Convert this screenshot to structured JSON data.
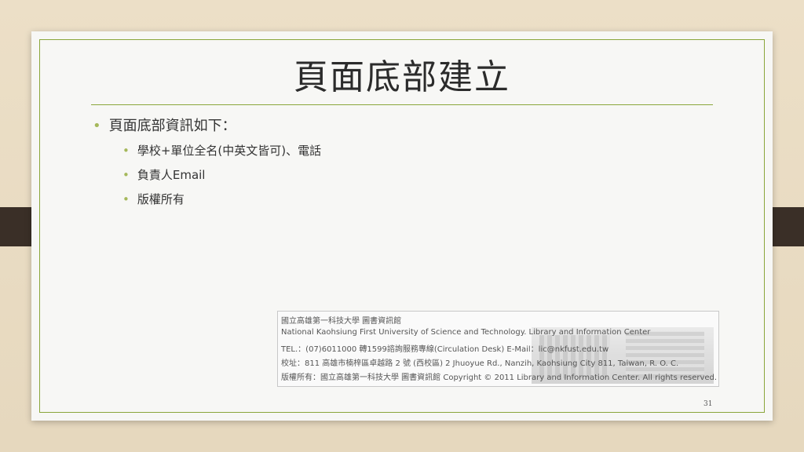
{
  "slide": {
    "title": "頁面底部建立",
    "main_bullet": "頁面底部資訊如下：",
    "sub_bullets": [
      "學校+單位全名(中英文皆可)、電話",
      "負責人Email",
      "版權所有"
    ],
    "page_number": "31"
  },
  "footer_example": {
    "line1": "國立高雄第一科技大學 圖書資訊館",
    "line2": "National Kaohsiung First University of Science and Technology. Library and Information Center",
    "line3": "TEL.：(07)6011000 轉1599諮詢服務專線(Circulation Desk) E-Mail：lic@nkfust.edu.tw",
    "line4": "校址：811 高雄市楠梓區卓越路 2 號 (西校區) 2 Jhuoyue Rd., Nanzih, Kaohsiung City 811, Taiwan, R. O. C.",
    "line5": "版權所有：國立高雄第一科技大學 圖書資訊館 Copyright © 2011 Library and Information Center. All rights reserved."
  },
  "colors": {
    "accent": "#8aa63a",
    "background": "#e9dcc4",
    "clip": "#3a2f27"
  }
}
